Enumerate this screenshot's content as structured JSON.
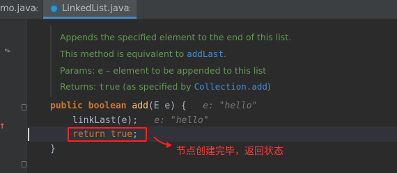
{
  "tabs": [
    {
      "label": "mo.java",
      "close": "×"
    },
    {
      "label": "LinkedList.java",
      "close": "×"
    }
  ],
  "doc": {
    "line1": "Appends the specified element to the end of this list.",
    "line2_text": "This method is equivalent to ",
    "line2_code": "addLast",
    "line2_end": ".",
    "params_label": "Params: ",
    "params_text": "e – element to be appended to this list",
    "returns_label": "Returns: ",
    "returns_true": "true",
    "returns_mid": " (as specified by ",
    "returns_code": "Collection.add",
    "returns_end": ")"
  },
  "code": {
    "sig_public": "public",
    "sig_boolean": "boolean",
    "sig_name": "add",
    "sig_rest_1": "(",
    "sig_E": "E",
    "sig_rest_2": " e) {",
    "sig_hint": "e: \"hello\"",
    "l2_name": "linkLast",
    "l2_rest": "(e);",
    "l2_hint": "e: \"hello\"",
    "l3_return": "return",
    "l3_true": "true",
    "l3_semi": ";",
    "l4": "}"
  },
  "annotation": "节点创建完毕，返回状态",
  "colors": {
    "highlight": "#ff2222",
    "keyword": "#cc7832",
    "doc": "#629755"
  }
}
